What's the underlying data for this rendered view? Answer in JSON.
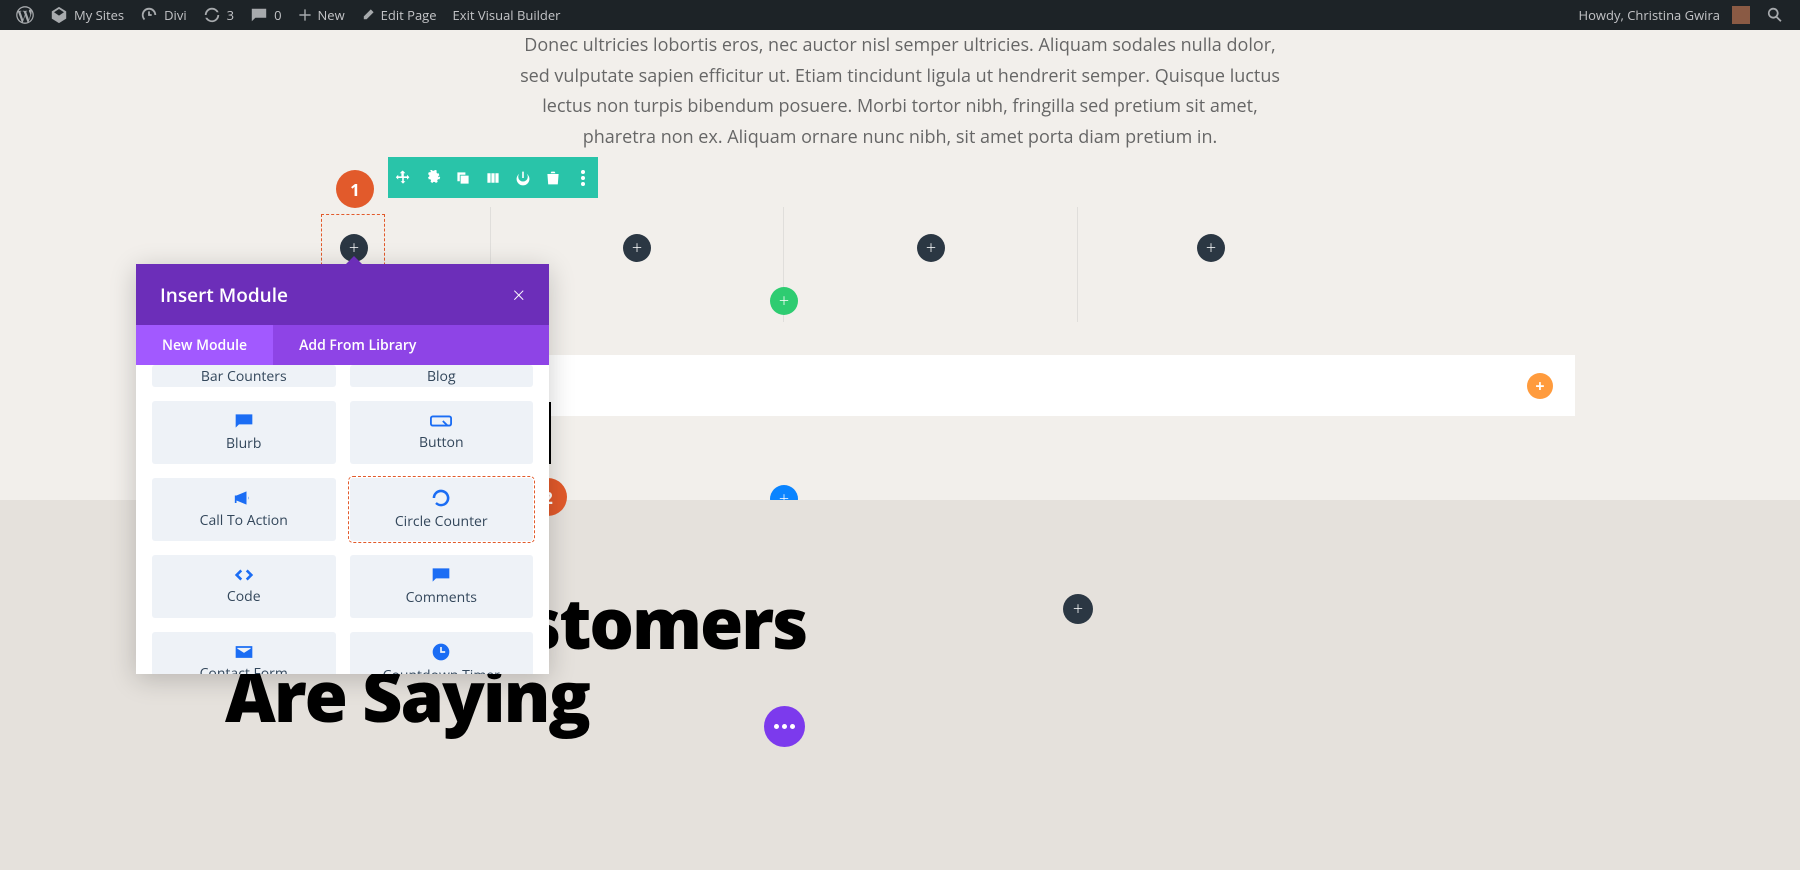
{
  "adminbar": {
    "my_sites": "My Sites",
    "divi": "Divi",
    "updates": "3",
    "comments": "0",
    "new": "New",
    "edit_page": "Edit Page",
    "exit_vb": "Exit Visual Builder",
    "howdy": "Howdy, Christina Gwira"
  },
  "intro_text": "Donec ultricies lobortis eros, nec auctor nisl semper ultricies. Aliquam sodales nulla dolor, sed vulputate sapien efficitur ut. Etiam tincidunt ligula ut hendrerit semper. Quisque luctus lectus non turpis bibendum posuere. Morbi tortor nibh, fringilla sed pretium sit amet, pharetra non ex. Aliquam ornare nunc nibh, sit amet porta diam pretium in.",
  "markers": {
    "m1": "1",
    "m2": "2"
  },
  "popup": {
    "title": "Insert Module",
    "tab_new": "New Module",
    "tab_lib": "Add From Library",
    "items": {
      "bar_counters": "Bar Counters",
      "blog": "Blog",
      "blurb": "Blurb",
      "button": "Button",
      "cta": "Call To Action",
      "circle": "Circle Counter",
      "code": "Code",
      "comments": "Comments",
      "contact": "Contact Form",
      "countdown": "Countdown Timer"
    }
  },
  "lower_heading_l1": "stomers",
  "lower_heading_l2": "Are Saying",
  "colors": {
    "purple": "#6c2eb9",
    "teal": "#29c4a9",
    "orange": "#e25a2b",
    "add_green": "#2ecc71"
  }
}
